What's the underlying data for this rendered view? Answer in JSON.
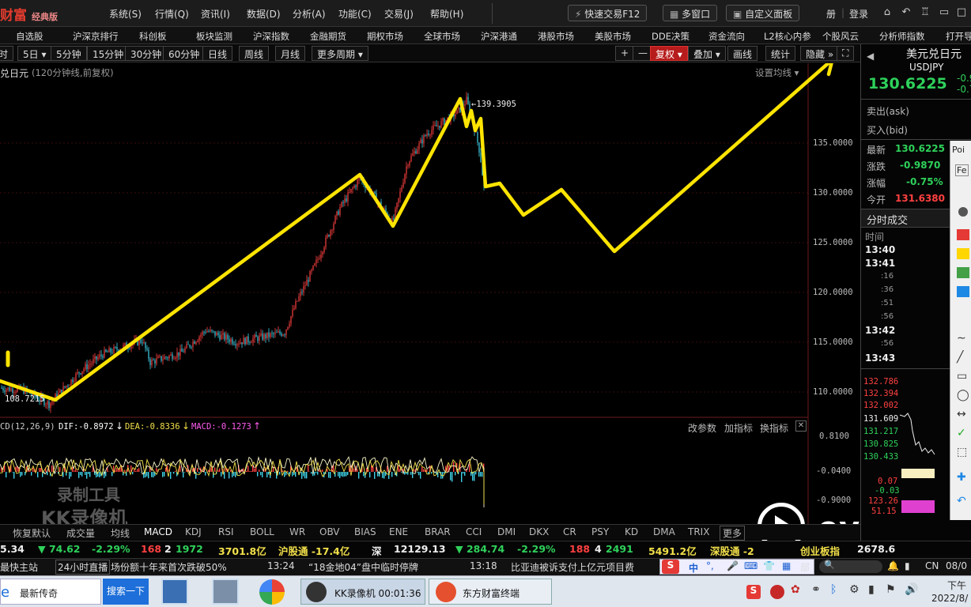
{
  "app": {
    "logo": "财富",
    "edition": "经典版",
    "menu": [
      "系统(S)",
      "行情(Q)",
      "资讯(I)",
      "数据(D)",
      "分析(A)",
      "功能(C)",
      "交易(J)",
      "帮助(H)"
    ],
    "buttons": [
      "快速交易F12",
      "多窗口",
      "自定义面板"
    ],
    "login_left": "册",
    "login": "登录"
  },
  "nav": [
    "自选股",
    "沪深京排行",
    "科创板",
    "板块监测",
    "沪深指数",
    "金融期货",
    "期权市场",
    "全球市场",
    "沪深港通",
    "港股市场",
    "美股市场",
    "DDE决策",
    "资金流向",
    "L2核心内参",
    "个股风云",
    "分析师指数",
    "打开导"
  ],
  "periods": {
    "items": [
      "时",
      "5日",
      "5分钟",
      "15分钟",
      "30分钟",
      "60分钟",
      "日线",
      "周线",
      "月线",
      "更多周期"
    ],
    "right": [
      "+",
      "—",
      "复权",
      "叠加",
      "画线",
      "统计",
      "隐藏"
    ]
  },
  "chart_header": {
    "title": "兑日元",
    "subtitle": "(120分钟线,前复权)",
    "settings": "设置均线"
  },
  "chart_data": {
    "type": "candlestick",
    "price_axis": [
      "135.0000",
      "130.0000",
      "125.0000",
      "120.0000",
      "115.0000",
      "110.0000"
    ],
    "high_label": "139.3905",
    "low_label": "108.7215",
    "ylim": [
      108,
      141
    ]
  },
  "macd": {
    "label": "CD(12,26,9)",
    "dif": "DIF:-0.8972",
    "dea": "DEA:-0.8336",
    "macd": "MACD:-0.1273",
    "tools": [
      "改参数",
      "加指标",
      "换指标"
    ],
    "axis": [
      "0.8100",
      "-0.0400",
      "-0.9000"
    ]
  },
  "watermark": {
    "line1": "录制工具",
    "line2": "KK录像机",
    "editor": "ev剪辑"
  },
  "indicators": [
    "恢复默认",
    "成交量",
    "均线",
    "MACD",
    "KDJ",
    "RSI",
    "BOLL",
    "WR",
    "OBV",
    "BIAS",
    "ENE",
    "BRAR",
    "CCI",
    "DMI",
    "DKX",
    "CR",
    "PSY",
    "KD",
    "DMA",
    "TRIX",
    "更多"
  ],
  "ticker": [
    {
      "t": "5.34",
      "c": "white"
    },
    {
      "t": "▼ 74.62",
      "c": "green"
    },
    {
      "t": "-2.29%",
      "c": "green"
    },
    {
      "t": "168",
      "c": "red"
    },
    {
      "t": "2",
      "c": "white"
    },
    {
      "t": "1972",
      "c": "green"
    },
    {
      "t": "3701.8亿",
      "c": "yellow"
    },
    {
      "t": "沪股通 -17.4亿",
      "c": "yellow"
    },
    {
      "t": "深",
      "c": "white"
    },
    {
      "t": "12129.13",
      "c": "white"
    },
    {
      "t": "▼ 284.74",
      "c": "green"
    },
    {
      "t": "-2.29%",
      "c": "green"
    },
    {
      "t": "188",
      "c": "red"
    },
    {
      "t": "4",
      "c": "white"
    },
    {
      "t": "2491",
      "c": "green"
    },
    {
      "t": "5491.2亿",
      "c": "yellow"
    },
    {
      "t": "深股通 -2",
      "c": "yellow"
    },
    {
      "t": "创业板指",
      "c": "yellow"
    },
    {
      "t": "2678.6",
      "c": "white"
    }
  ],
  "news": [
    "最快主站",
    "24小时直播",
    "场份额十年来首次跌破50%",
    "13:24",
    "“18金地04”盘中临时停牌",
    "13:18",
    "比亚迪被诉支付上亿元项目费"
  ],
  "right_panel": {
    "name": "美元兑日元",
    "code": "USDJPY",
    "price": "130.6225",
    "chg1": "-0.9",
    "chg2": "-0.7",
    "ask": "卖出(ask)",
    "bid": "买入(bid)",
    "rows": [
      {
        "k": "最新",
        "v": "130.6225",
        "c": "green"
      },
      {
        "k": "涨跌",
        "v": "-0.9870",
        "c": "green"
      },
      {
        "k": "涨幅",
        "v": "-0.75%",
        "c": "green"
      },
      {
        "k": "今开",
        "v": "131.6380",
        "c": "red"
      }
    ],
    "trades_title": "分时成交",
    "time_header": "时间",
    "times": [
      "13:40",
      "13:41",
      ":16",
      ":36",
      ":51",
      ":56",
      "13:42",
      ":56",
      "13:43"
    ],
    "mini_axis": [
      "132.786",
      "132.394",
      "132.002",
      "131.609",
      "131.217",
      "130.825",
      "130.433",
      "0.07",
      "-0.03",
      "123.26",
      "51.15"
    ]
  },
  "tool_window": {
    "label": "Poi",
    "sub": "Fe"
  },
  "taskbar": {
    "browser": "最新传奇",
    "search": "搜索一下",
    "kk": "KK录像机 00:01:36",
    "df": "东方财富终端",
    "ime": "中",
    "cn": "CN",
    "date": "08/0",
    "time_lbl": "下午",
    "date_full": "2022/8/"
  },
  "colors": {
    "yellow_line": "#ffe400",
    "up": "#ff4040",
    "down": "#3fd1e8",
    "green": "#2ed15a"
  }
}
